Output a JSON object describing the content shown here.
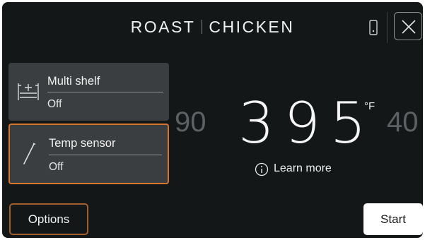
{
  "header": {
    "title_left": "ROAST",
    "title_right": "CHICKEN",
    "phone_icon": "phone-icon",
    "close_icon": "close-icon"
  },
  "cards": {
    "multi_shelf": {
      "label": "Multi shelf",
      "value": "Off",
      "icon": "shelf-icon"
    },
    "temp_sensor": {
      "label": "Temp sensor",
      "value": "Off",
      "icon": "probe-icon",
      "selected": true
    }
  },
  "temperature": {
    "prev": "90",
    "current": "395",
    "next": "40",
    "unit": "°F"
  },
  "learn_more": {
    "label": "Learn more",
    "icon": "info-icon"
  },
  "footer": {
    "options_label": "Options",
    "start_label": "Start"
  },
  "colors": {
    "background": "#141718",
    "card": "#3a3e40",
    "accent": "#d9742c",
    "faded_text": "#5d6164"
  }
}
